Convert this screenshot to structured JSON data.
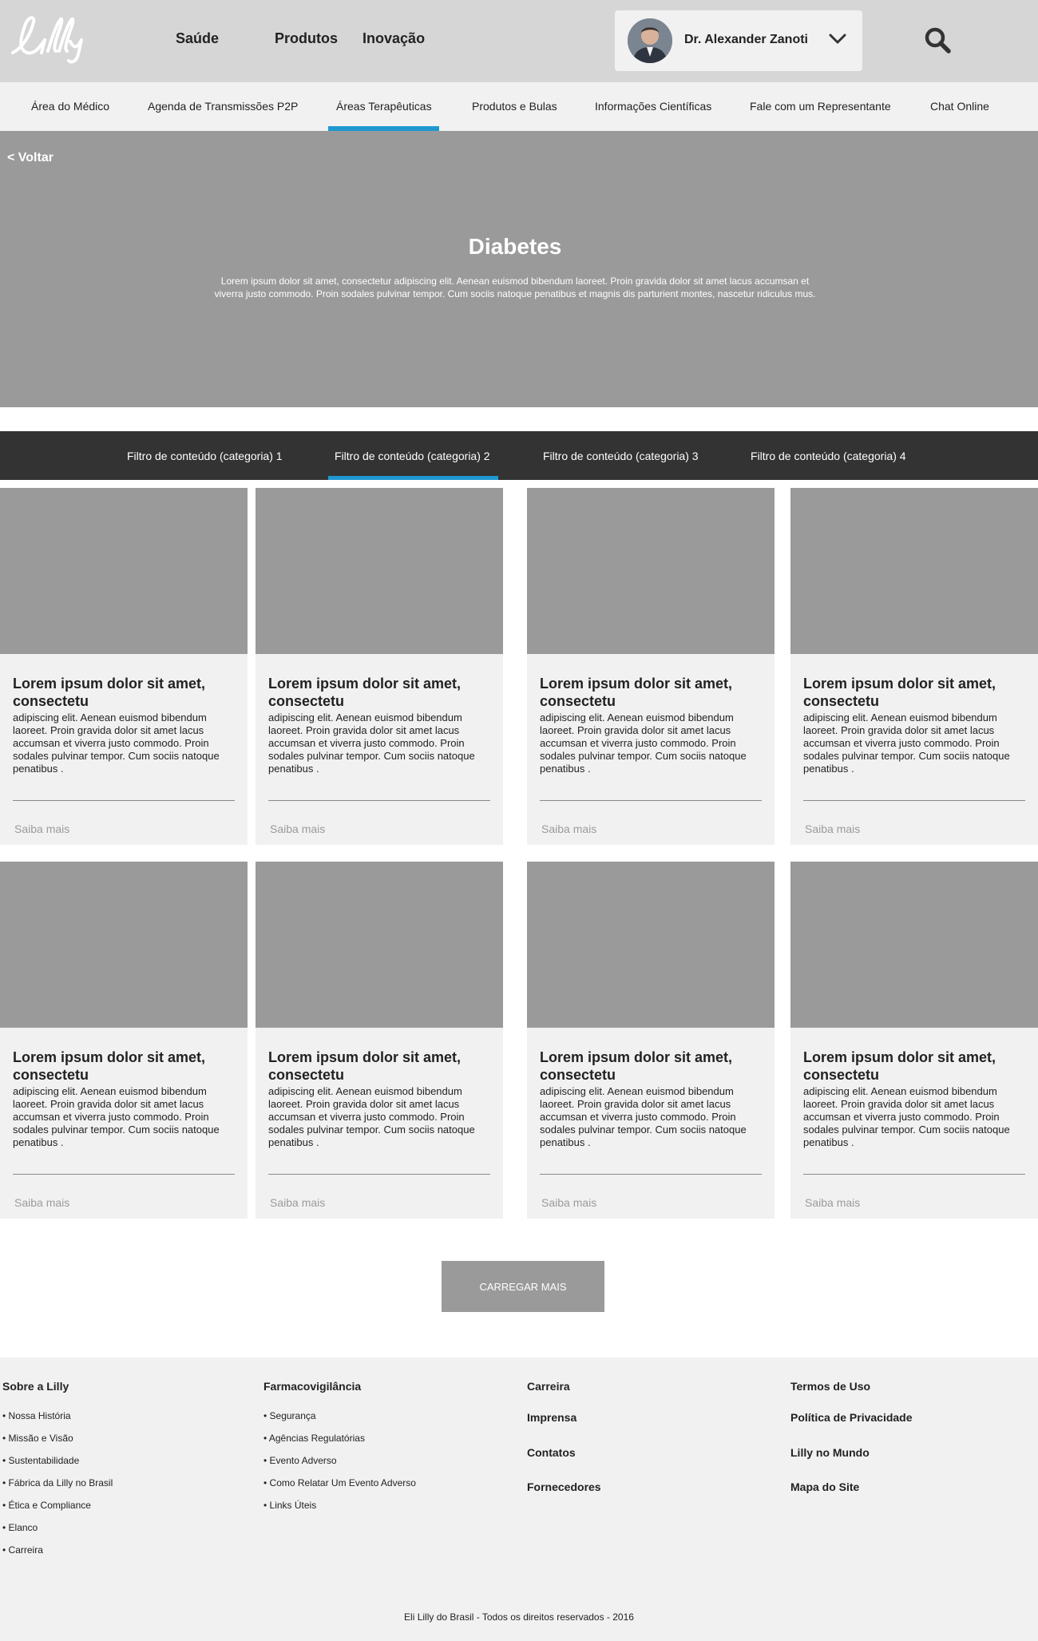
{
  "header": {
    "nav": [
      "Saúde",
      "Produtos",
      "Inovação"
    ],
    "user_name": "Dr. Alexander Zanoti"
  },
  "sub_nav": [
    "Área do Médico",
    "Agenda de Transmissões P2P",
    "Áreas Terapêuticas",
    "Produtos e Bulas",
    "Informações Científicas",
    "Fale com um Representante",
    "Chat Online"
  ],
  "hero": {
    "back": "< Voltar",
    "title": "Diabetes",
    "text": "Lorem ipsum dolor sit amet, consectetur adipiscing elit. Aenean euismod bibendum laoreet. Proin gravida dolor sit amet lacus accumsan et viverra justo commodo. Proin sodales pulvinar tempor. Cum sociis natoque penatibus et magnis dis parturient montes, nascetur ridiculus mus."
  },
  "filters": [
    "Filtro de conteúdo (categoria) 1",
    "Filtro de conteúdo (categoria) 2",
    "Filtro de conteúdo (categoria) 3",
    "Filtro de conteúdo (categoria) 4"
  ],
  "cards": [
    {
      "title": "Lorem ipsum dolor sit amet, consectetu",
      "text": "adipiscing elit. Aenean euismod bibendum laoreet. Proin gravida dolor sit amet lacus accumsan et viverra justo commodo. Proin sodales pulvinar tempor. Cum sociis natoque penatibus .",
      "link": "Saiba mais"
    },
    {
      "title": "Lorem ipsum dolor sit amet, consectetu",
      "text": "adipiscing elit. Aenean euismod bibendum laoreet. Proin gravida dolor sit amet lacus accumsan et viverra justo commodo. Proin sodales pulvinar tempor. Cum sociis natoque penatibus .",
      "link": "Saiba mais"
    },
    {
      "title": "Lorem ipsum dolor sit amet, consectetu",
      "text": "adipiscing elit. Aenean euismod bibendum laoreet. Proin gravida dolor sit amet lacus accumsan et viverra justo commodo. Proin sodales pulvinar tempor. Cum sociis natoque penatibus .",
      "link": "Saiba mais"
    },
    {
      "title": "Lorem ipsum dolor sit amet, consectetu",
      "text": "adipiscing elit. Aenean euismod bibendum laoreet. Proin gravida dolor sit amet lacus accumsan et viverra justo commodo. Proin sodales pulvinar tempor. Cum sociis natoque penatibus .",
      "link": "Saiba mais"
    },
    {
      "title": "Lorem ipsum dolor sit amet, consectetu",
      "text": "adipiscing elit. Aenean euismod bibendum laoreet. Proin gravida dolor sit amet lacus accumsan et viverra justo commodo. Proin sodales pulvinar tempor. Cum sociis natoque penatibus .",
      "link": "Saiba mais"
    },
    {
      "title": "Lorem ipsum dolor sit amet, consectetu",
      "text": "adipiscing elit. Aenean euismod bibendum laoreet. Proin gravida dolor sit amet lacus accumsan et viverra justo commodo. Proin sodales pulvinar tempor. Cum sociis natoque penatibus .",
      "link": "Saiba mais"
    },
    {
      "title": "Lorem ipsum dolor sit amet, consectetu",
      "text": "adipiscing elit. Aenean euismod bibendum laoreet. Proin gravida dolor sit amet lacus accumsan et viverra justo commodo. Proin sodales pulvinar tempor. Cum sociis natoque penatibus .",
      "link": "Saiba mais"
    },
    {
      "title": "Lorem ipsum dolor sit amet, consectetu",
      "text": "adipiscing elit. Aenean euismod bibendum laoreet. Proin gravida dolor sit amet lacus accumsan et viverra justo commodo. Proin sodales pulvinar tempor. Cum sociis natoque penatibus .",
      "link": "Saiba mais"
    }
  ],
  "load_more": "CARREGAR MAIS",
  "footer": {
    "col1": {
      "heading": "Sobre a Lilly",
      "items": [
        "• Nossa História",
        "• Missão e Visão",
        "• Sustentabilidade",
        "• Fábrica da Lilly no Brasil",
        "• Ética e Compliance",
        "• Elanco",
        "• Carreira"
      ]
    },
    "col2": {
      "heading": "Farmacovigilância",
      "items": [
        "• Segurança",
        "• Agências Regulatórias",
        "• Evento Adverso",
        "• Como Relatar Um Evento Adverso",
        "• Links Úteis"
      ]
    },
    "col3": [
      "Carreira",
      "Imprensa",
      "Contatos",
      "Fornecedores"
    ],
    "col4": [
      "Termos de Uso",
      "Política de Privacidade",
      "Lilly no Mundo",
      "Mapa do Site"
    ],
    "copyright": "Eli Lilly do Brasil - Todos os direitos reservados - 2016"
  },
  "colors": {
    "accent": "#1f98d2",
    "header_bg": "#d6d6d6",
    "placeholder": "#9a9a9a",
    "dark_bar": "#333333"
  },
  "icons": [
    "lilly-logo",
    "avatar",
    "chevron-down-icon",
    "search-icon"
  ]
}
